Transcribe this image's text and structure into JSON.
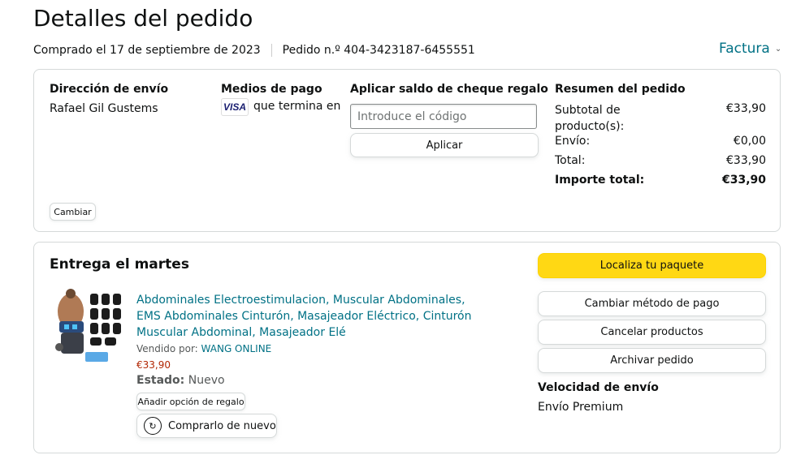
{
  "header": {
    "title": "Detalles del pedido",
    "purchased": "Comprado el 17 de septiembre de 2023",
    "order_number": "Pedido n.º 404-3423187-6455551",
    "invoice": "Factura"
  },
  "shipping": {
    "heading": "Dirección de envío",
    "name": "Rafael Gil Gustems",
    "change_label": "Cambiar"
  },
  "payment": {
    "heading": "Medios de pago",
    "card_brand": "VISA",
    "ending": "que termina en"
  },
  "gift": {
    "heading": "Aplicar saldo de cheque regalo",
    "placeholder": "Introduce el código",
    "apply_label": "Aplicar"
  },
  "summary": {
    "heading": "Resumen del pedido",
    "rows": [
      {
        "label": "Subtotal de",
        "label2": "producto(s):",
        "value": "€33,90"
      },
      {
        "label": "Envío:",
        "value": "€0,00"
      },
      {
        "label": "Total:",
        "value": "€33,90"
      },
      {
        "label": "Importe total:",
        "value": "€33,90"
      }
    ]
  },
  "delivery": {
    "heading": "Entrega el martes",
    "product": {
      "title": "Abdominales Electroestimulacion, Muscular Abdominales, EMS Abdominales Cinturón, Masajeador Eléctrico, Cinturón Muscular Abdominal, Masajeador Elé",
      "sold_by_label": "Vendido por:",
      "seller": "WANG ONLINE",
      "price": "€33,90",
      "state_label": "Estado:",
      "state_value": "Nuevo",
      "gift_option": "Añadir opción de regalo",
      "buy_again": "Comprarlo de nuevo"
    },
    "actions": {
      "track": "Localiza tu paquete",
      "change_payment": "Cambiar método de pago",
      "cancel": "Cancelar productos",
      "archive": "Archivar pedido"
    },
    "speed_heading": "Velocidad de envío",
    "speed_value": "Envío Premium"
  },
  "colors": {
    "link": "#007185",
    "price": "#B12704",
    "primary_button": "#FFD814"
  }
}
